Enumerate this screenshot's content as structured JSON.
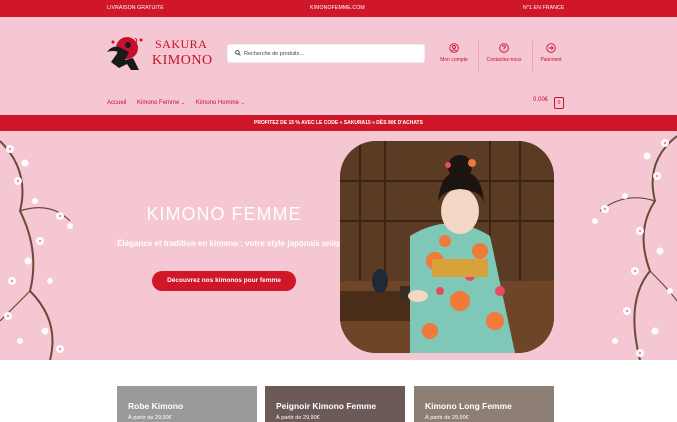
{
  "topbar": {
    "left": "LIVRAISON GRATUITE",
    "center": "KIMONOFEMME.COM",
    "right": "N°1 EN FRANCE"
  },
  "logo": {
    "line1": "SAKURA",
    "line2": "KIMONO"
  },
  "search": {
    "placeholder": "Recherche de produits…"
  },
  "header_links": [
    {
      "label": "Mon compte",
      "icon": "user-icon"
    },
    {
      "label": "Contactez-nous",
      "icon": "help-icon"
    },
    {
      "label": "Paiement",
      "icon": "arrow-right-circle-icon"
    }
  ],
  "nav": {
    "items": [
      "Accueil",
      "Kimono Femme",
      "Kimono Homme"
    ]
  },
  "cart": {
    "total": "0,00€",
    "count": "0"
  },
  "promo": {
    "text": "PROFITEZ DE 15 % AVEC LE CODE « SAKURA15 » DÈS 80€ D'ACHATS"
  },
  "hero": {
    "title": "KIMONO FEMME",
    "subtitle": "Élégance et tradition en kimono : votre style japonais unique!",
    "button": "Découvrez nos kimonos pour femme"
  },
  "cards": [
    {
      "title": "Robe Kimono",
      "price": "À partir de 29,90€"
    },
    {
      "title": "Peignoir Kimono Femme",
      "price": "À partir de 29,90€"
    },
    {
      "title": "Kimono Long Femme",
      "price": "À partir de 29,90€"
    }
  ],
  "colors": {
    "brand_red": "#d0172a",
    "pink_bg": "#f5c7d2"
  }
}
